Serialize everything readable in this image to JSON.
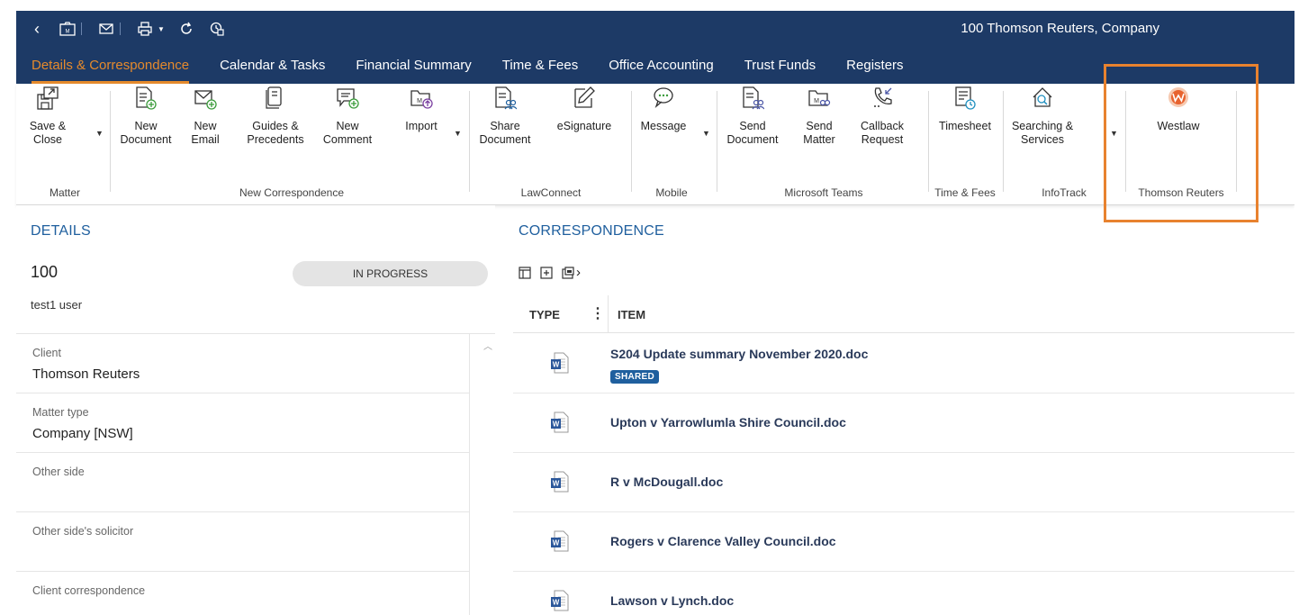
{
  "window": {
    "title": "100 Thomson Reuters, Company"
  },
  "tabs": [
    {
      "label": "Details & Correspondence",
      "active": true
    },
    {
      "label": "Calendar & Tasks"
    },
    {
      "label": "Financial Summary"
    },
    {
      "label": "Time & Fees"
    },
    {
      "label": "Office Accounting"
    },
    {
      "label": "Trust Funds"
    },
    {
      "label": "Registers"
    }
  ],
  "ribbon": {
    "groups": {
      "matter": "Matter",
      "new_correspondence": "New Correspondence",
      "lawconnect": "LawConnect",
      "mobile": "Mobile",
      "microsoft_teams": "Microsoft Teams",
      "time_fees": "Time & Fees",
      "infotrack": "InfoTrack",
      "thomson_reuters": "Thomson Reuters"
    },
    "buttons": {
      "save_close": "Save &\nClose",
      "new_document": "New\nDocument",
      "new_email": "New\nEmail",
      "guides_precedents": "Guides &\nPrecedents",
      "new_comment": "New\nComment",
      "import": "Import",
      "share_document": "Share\nDocument",
      "esignature": "eSignature",
      "message": "Message",
      "send_document": "Send\nDocument",
      "send_matter": "Send\nMatter",
      "callback_request": "Callback\nRequest",
      "timesheet": "Timesheet",
      "searching_services": "Searching &\nServices",
      "westlaw": "Westlaw"
    }
  },
  "details": {
    "heading": "DETAILS",
    "matter_number": "100",
    "status": "IN PROGRESS",
    "user": "test1 user",
    "fields": [
      {
        "label": "Client",
        "value": "Thomson Reuters"
      },
      {
        "label": "Matter type",
        "value": "Company [NSW]"
      },
      {
        "label": "Other side",
        "value": ""
      },
      {
        "label": "Other side's solicitor",
        "value": ""
      },
      {
        "label": "Client correspondence",
        "value": ""
      }
    ]
  },
  "correspondence": {
    "heading": "CORRESPONDENCE",
    "columns": {
      "type": "TYPE",
      "item": "ITEM"
    },
    "rows": [
      {
        "name": "S204 Update summary November 2020.doc",
        "badge": "SHARED"
      },
      {
        "name": "Upton v Yarrowlumla Shire Council.doc"
      },
      {
        "name": "R v McDougall.doc"
      },
      {
        "name": "Rogers v Clarence Valley Council.doc"
      },
      {
        "name": "Lawson v Lynch.doc"
      }
    ]
  },
  "colors": {
    "nav": "#1d3a66",
    "accent": "#e58a2c",
    "heading": "#1f5f9e",
    "highlight": "#e8822f"
  }
}
